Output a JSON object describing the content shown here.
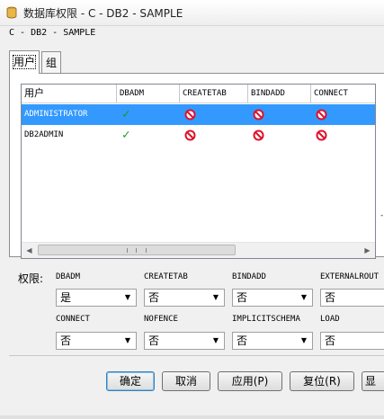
{
  "window": {
    "title": "数据库权限 - C - DB2 - SAMPLE",
    "path_label": "C - DB2 - SAMPLE"
  },
  "tabs": [
    {
      "label": "用户",
      "active": true
    },
    {
      "label": "组",
      "active": false
    }
  ],
  "grid": {
    "columns": [
      "用户",
      "DBADM",
      "CREATETAB",
      "BINDADD",
      "CONNECT"
    ],
    "rows": [
      {
        "user": "ADMINISTRATOR",
        "selected": true,
        "perms": [
          "check",
          "deny",
          "deny",
          "deny"
        ]
      },
      {
        "user": "DB2ADMIN",
        "selected": false,
        "perms": [
          "check",
          "deny",
          "deny",
          "deny"
        ]
      }
    ]
  },
  "permissions": {
    "label": "权限:",
    "fields": [
      {
        "label": "DBADM",
        "value": "是"
      },
      {
        "label": "CREATETAB",
        "value": "否"
      },
      {
        "label": "BINDADD",
        "value": "否"
      },
      {
        "label": "EXTERNALROUT",
        "value": "否"
      },
      {
        "label": "CONNECT",
        "value": "否"
      },
      {
        "label": "NOFENCE",
        "value": "否"
      },
      {
        "label": "IMPLICITSCHEMA",
        "value": "否"
      },
      {
        "label": "LOAD",
        "value": "否"
      }
    ]
  },
  "buttons": {
    "ok": "确定",
    "cancel": "取消",
    "apply": "应用(P)",
    "reset": "复位(R)",
    "show": "显"
  },
  "colors": {
    "selection": "#3399ff",
    "check": "#1a9a1a",
    "deny": "#e0102a"
  }
}
